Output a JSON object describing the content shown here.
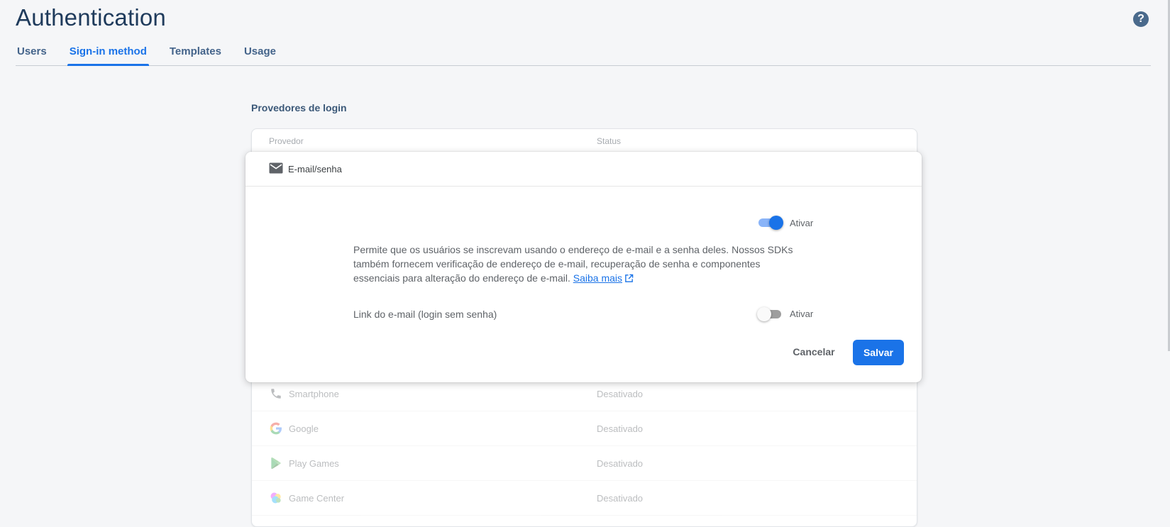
{
  "header": {
    "title": "Authentication",
    "help_glyph": "?"
  },
  "tabs": [
    {
      "label": "Users",
      "active": false
    },
    {
      "label": "Sign-in method",
      "active": true
    },
    {
      "label": "Templates",
      "active": false
    },
    {
      "label": "Usage",
      "active": false
    }
  ],
  "providers": {
    "section_title": "Provedores de login",
    "columns": {
      "provider": "Provedor",
      "status": "Status"
    },
    "rows": [
      {
        "name": "Smartphone",
        "status": "Desativado",
        "icon": "phone-icon"
      },
      {
        "name": "Google",
        "status": "Desativado",
        "icon": "google-icon"
      },
      {
        "name": "Play Games",
        "status": "Desativado",
        "icon": "play-games-icon"
      },
      {
        "name": "Game Center",
        "status": "Desativado",
        "icon": "game-center-icon"
      }
    ]
  },
  "editor": {
    "title": "E-mail/senha",
    "icon": "mail-icon",
    "enable_toggle": {
      "label": "Ativar",
      "on": true
    },
    "description": "Permite que os usuários se inscrevam usando o endereço de e-mail e a senha deles. Nossos SDKs também fornecem verificação de endereço de e-mail, recuperação de senha e componentes essenciais para alteração do endereço de e-mail.",
    "learn_more": "Saiba mais",
    "email_link": {
      "label": "Link do e-mail (login sem senha)",
      "toggle_label": "Ativar",
      "on": false
    },
    "cancel_label": "Cancelar",
    "save_label": "Salvar"
  },
  "colors": {
    "accent": "#1a73e8",
    "title": "#1f3b5c",
    "tab": "#43638a"
  }
}
